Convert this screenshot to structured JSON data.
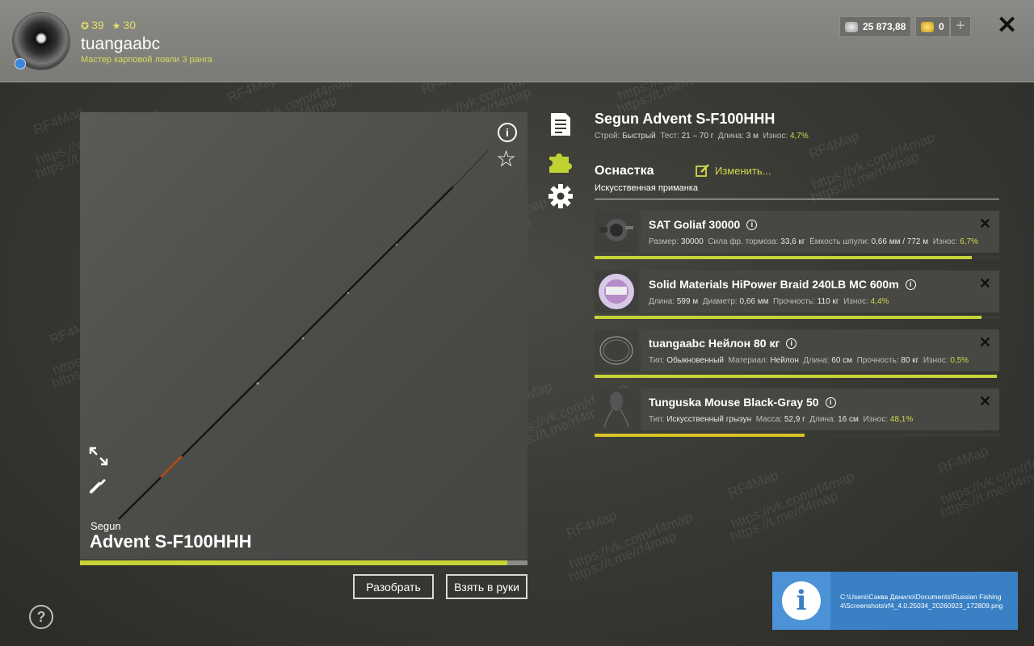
{
  "player": {
    "level": "39",
    "stars": "30",
    "username": "tuangaabc",
    "rank": "Мастер карповой ловли 3 ранга"
  },
  "wallet": {
    "silver": "25 873,88",
    "gold": "0",
    "add_label": "+"
  },
  "close_label": "✕",
  "rod": {
    "brand": "Segun",
    "model": "Advent S-F100HHH",
    "condition_fraction": 0.955
  },
  "buttons": {
    "disassemble": "Разобрать",
    "take_in_hands": "Взять в руки"
  },
  "item": {
    "title": "Segun Advent S-F100HHH",
    "specs": {
      "action_label": "Строй:",
      "action_value": "Быстрый",
      "test_label": "Тест:",
      "test_value": "21 – 70 г",
      "length_label": "Длина:",
      "length_value": "3 м",
      "wear_label": "Износ:",
      "wear_value": "4,7%"
    }
  },
  "rig": {
    "title": "Оснастка",
    "edit_label": "Изменить...",
    "subtitle": "Искусственная приманка"
  },
  "components": [
    {
      "name": "SAT Goliaf 30000",
      "specs": [
        {
          "label": "Размер:",
          "value": "30000"
        },
        {
          "label": "Сила фр. тормоза:",
          "value": "33,6 кг"
        },
        {
          "label": "Ёмкость шпули:",
          "value": "0,66 мм / 772 м"
        },
        {
          "label": "Износ:",
          "value": "6,7%",
          "highlight": true
        }
      ],
      "condition_fraction": 0.933
    },
    {
      "name": "Solid Materials HiPower Braid 240LB MC 600m",
      "specs": [
        {
          "label": "Длина:",
          "value": "599 м"
        },
        {
          "label": "Диаметр:",
          "value": "0,66 мм"
        },
        {
          "label": "Прочность:",
          "value": "110 кг"
        },
        {
          "label": "Износ:",
          "value": "4,4%",
          "highlight": true
        }
      ],
      "condition_fraction": 0.956
    },
    {
      "name": "tuangaabc Нейлон 80 кг",
      "specs": [
        {
          "label": "Тип:",
          "value": "Обыкновенный"
        },
        {
          "label": "Материал:",
          "value": "Нейлон"
        },
        {
          "label": "Длина:",
          "value": "60 см"
        },
        {
          "label": "Прочность:",
          "value": "80 кг"
        },
        {
          "label": "Износ:",
          "value": "0,5%",
          "highlight": true
        }
      ],
      "condition_fraction": 0.995
    },
    {
      "name": "Tunguska Mouse Black-Gray 50",
      "specs": [
        {
          "label": "Тип:",
          "value": "Искусственный грызун"
        },
        {
          "label": "Масса:",
          "value": "52,9 г"
        },
        {
          "label": "Длина:",
          "value": "16 см"
        },
        {
          "label": "Износ:",
          "value": "48,1%",
          "highlight": true
        }
      ],
      "condition_fraction": 0.519
    }
  ],
  "help_label": "?",
  "toast": {
    "path": "C:\\Users\\Саква Данило\\Documents\\Russian Fishing 4\\Screenshots\\rf4_4.0.25034_20260923_172809.png"
  },
  "watermarks": [
    "RF4Map",
    "https://vk.com/rf4map",
    "https://t.me/rf4map"
  ],
  "colors": {
    "accent_yellow": "#d2d84a",
    "bar_green": "#c6d33a",
    "bar_yellow": "#d8c326",
    "toast_blue": "#3a80c4"
  }
}
